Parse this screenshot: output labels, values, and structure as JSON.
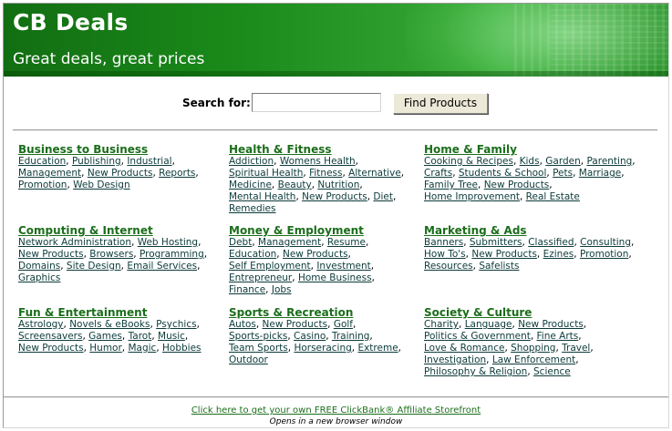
{
  "header": {
    "title": "CB Deals",
    "tagline": "Great deals, great prices"
  },
  "search": {
    "label": "Search for:",
    "value": "",
    "button_label": "Find Products"
  },
  "colors": {
    "banner_green": "#1a8a1a",
    "category_heading": "#1b6e1b",
    "link": "#0c3a3a"
  },
  "categories": [
    {
      "title": "Business to Business",
      "lines": [
        [
          "Education",
          "Publishing",
          "Industrial"
        ],
        [
          "Management",
          "New Products",
          "Reports"
        ],
        [
          "Promotion",
          "Web Design"
        ]
      ]
    },
    {
      "title": "Health & Fitness",
      "lines": [
        [
          "Addiction",
          "Womens Health"
        ],
        [
          "Spiritual Health",
          "Fitness",
          "Alternative"
        ],
        [
          "Medicine",
          "Beauty",
          "Nutrition"
        ],
        [
          "Mental Health",
          "New Products",
          "Diet"
        ],
        [
          "Remedies"
        ]
      ]
    },
    {
      "title": "Home & Family",
      "lines": [
        [
          "Cooking & Recipes",
          "Kids",
          "Garden",
          "Parenting"
        ],
        [
          "Crafts",
          "Students & School",
          "Pets",
          "Marriage"
        ],
        [
          "Family Tree",
          "New Products"
        ],
        [
          "Home Improvement",
          "Real Estate"
        ]
      ]
    },
    {
      "title": "Computing & Internet",
      "lines": [
        [
          "Network Administration",
          "Web Hosting"
        ],
        [
          "New Products",
          "Browsers",
          "Programming"
        ],
        [
          "Domains",
          "Site Design",
          "Email Services"
        ],
        [
          "Graphics"
        ]
      ]
    },
    {
      "title": "Money & Employment",
      "lines": [
        [
          "Debt",
          "Management",
          "Resume"
        ],
        [
          "Education",
          "New Products"
        ],
        [
          "Self Employment",
          "Investment"
        ],
        [
          "Entrepreneur",
          "Home Business"
        ],
        [
          "Finance",
          "Jobs"
        ]
      ]
    },
    {
      "title": "Marketing & Ads",
      "lines": [
        [
          "Banners",
          "Submitters",
          "Classified",
          "Consulting"
        ],
        [
          "How To's",
          "New Products",
          "Ezines",
          "Promotion"
        ],
        [
          "Resources",
          "Safelists"
        ]
      ]
    },
    {
      "title": "Fun & Entertainment",
      "lines": [
        [
          "Astrology",
          "Novels & eBooks",
          "Psychics"
        ],
        [
          "Screensavers",
          "Games",
          "Tarot",
          "Music"
        ],
        [
          "New Products",
          "Humor",
          "Magic",
          "Hobbies"
        ]
      ]
    },
    {
      "title": "Sports & Recreation",
      "lines": [
        [
          "Autos",
          "New Products",
          "Golf"
        ],
        [
          "Sports-picks",
          "Casino",
          "Training"
        ],
        [
          "Team Sports",
          "Horseracing",
          "Extreme"
        ],
        [
          "Outdoor"
        ]
      ]
    },
    {
      "title": "Society & Culture",
      "lines": [
        [
          "Charity",
          "Language",
          "New Products"
        ],
        [
          "Politics & Government",
          "Fine Arts"
        ],
        [
          "Love & Romance",
          "Shopping",
          "Travel"
        ],
        [
          "Investigation",
          "Law Enforcement"
        ],
        [
          "Philosophy & Religion",
          "Science"
        ]
      ]
    }
  ],
  "footer": {
    "link_text": "Click here to get your own FREE ClickBank® Affiliate Storefront",
    "note": "Opens in a new browser window"
  }
}
